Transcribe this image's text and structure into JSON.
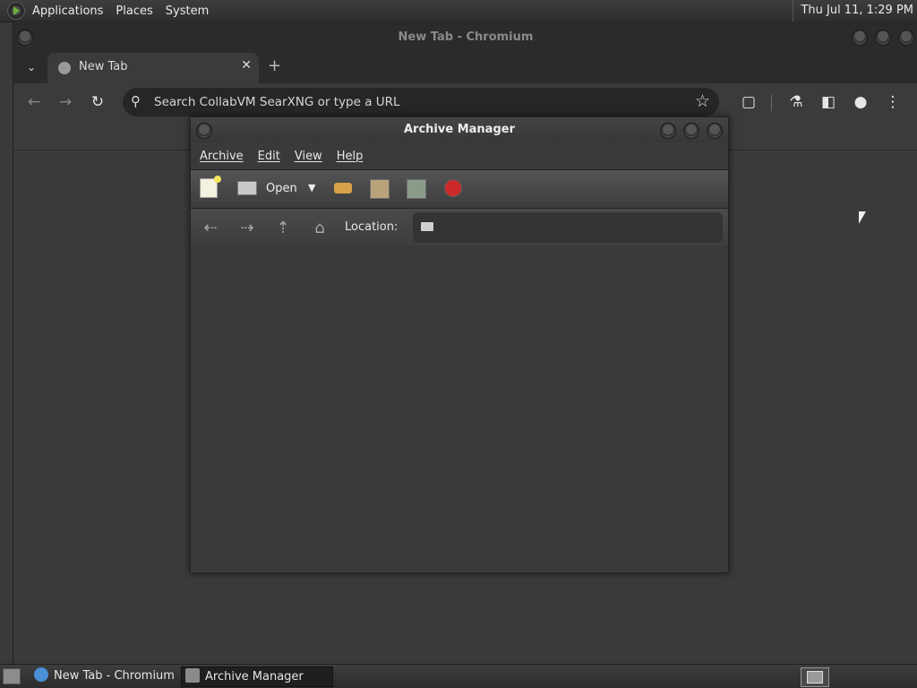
{
  "top_panel": {
    "menus": [
      "Applications",
      "Places",
      "System"
    ],
    "clock": "Thu Jul 11,  1:29 PM"
  },
  "chromium": {
    "window_title": "New Tab - Chromium",
    "tab_title": "New Tab",
    "omnibox_placeholder": "Search CollabVM SearXNG or type a URL"
  },
  "archive_manager": {
    "title": "Archive Manager",
    "menus": [
      "Archive",
      "Edit",
      "View",
      "Help"
    ],
    "toolbar": {
      "open_label": "Open"
    },
    "location_label": "Location:"
  },
  "taskbar": {
    "items": [
      "New Tab - Chromium",
      "Archive Manager"
    ]
  },
  "icons": {
    "chromium_nav": [
      "back-icon",
      "forward-icon",
      "reload-icon"
    ],
    "chromium_toolbar": [
      "extensions-icon",
      "labs-icon",
      "side-panel-icon",
      "profile-icon",
      "menu-icon"
    ],
    "archive_toolbar": [
      "new-archive-icon",
      "open-icon",
      "extract-icon",
      "add-files-icon",
      "add-folder-icon",
      "stop-icon"
    ],
    "archive_location": [
      "back-icon",
      "forward-icon",
      "up-icon",
      "home-icon",
      "folder-icon"
    ]
  },
  "colors": {
    "stop": "#cc2a2a",
    "extract": "#d8a24a",
    "background": "#3a3a3c"
  }
}
